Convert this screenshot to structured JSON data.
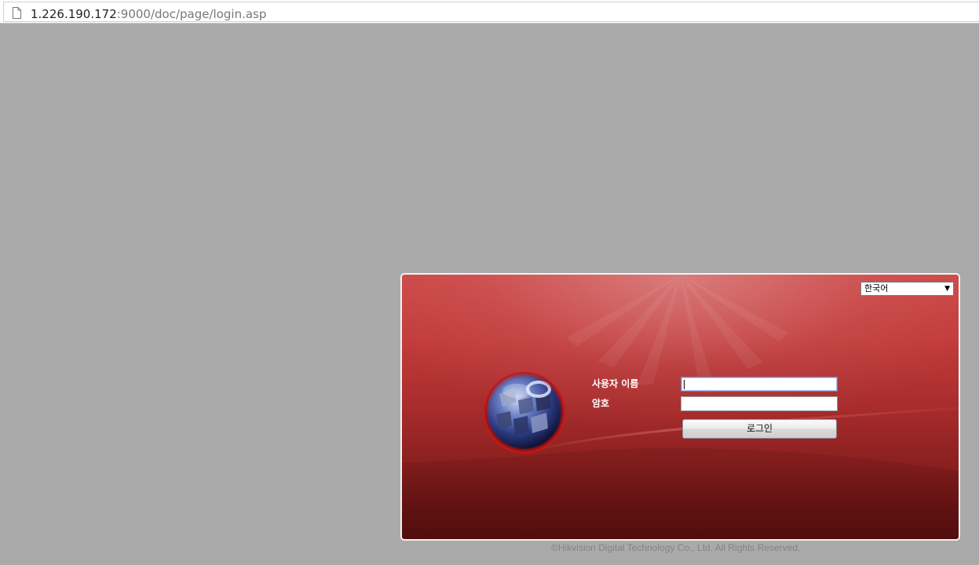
{
  "browser": {
    "url_host": "1.226.190.172",
    "url_rest": ":9000/doc/page/login.asp",
    "page_icon": "page-icon"
  },
  "login": {
    "language_selected": "한국어",
    "language_arrow": "▼",
    "username_label": "사용자 이름",
    "password_label": "암호",
    "username_value": "",
    "password_value": "",
    "login_button": "로그인",
    "logo_icon": "camera-globe-logo"
  },
  "footer": {
    "copyright": "©Hikvision Digital Technology Co., Ltd. All Rights Reserved."
  },
  "colors": {
    "background": "#aaaaaa",
    "panel_top": "#cc4848",
    "panel_bottom": "#5a0f0f",
    "panel_border": "#f2f2f2",
    "copyright_text": "#838383"
  }
}
